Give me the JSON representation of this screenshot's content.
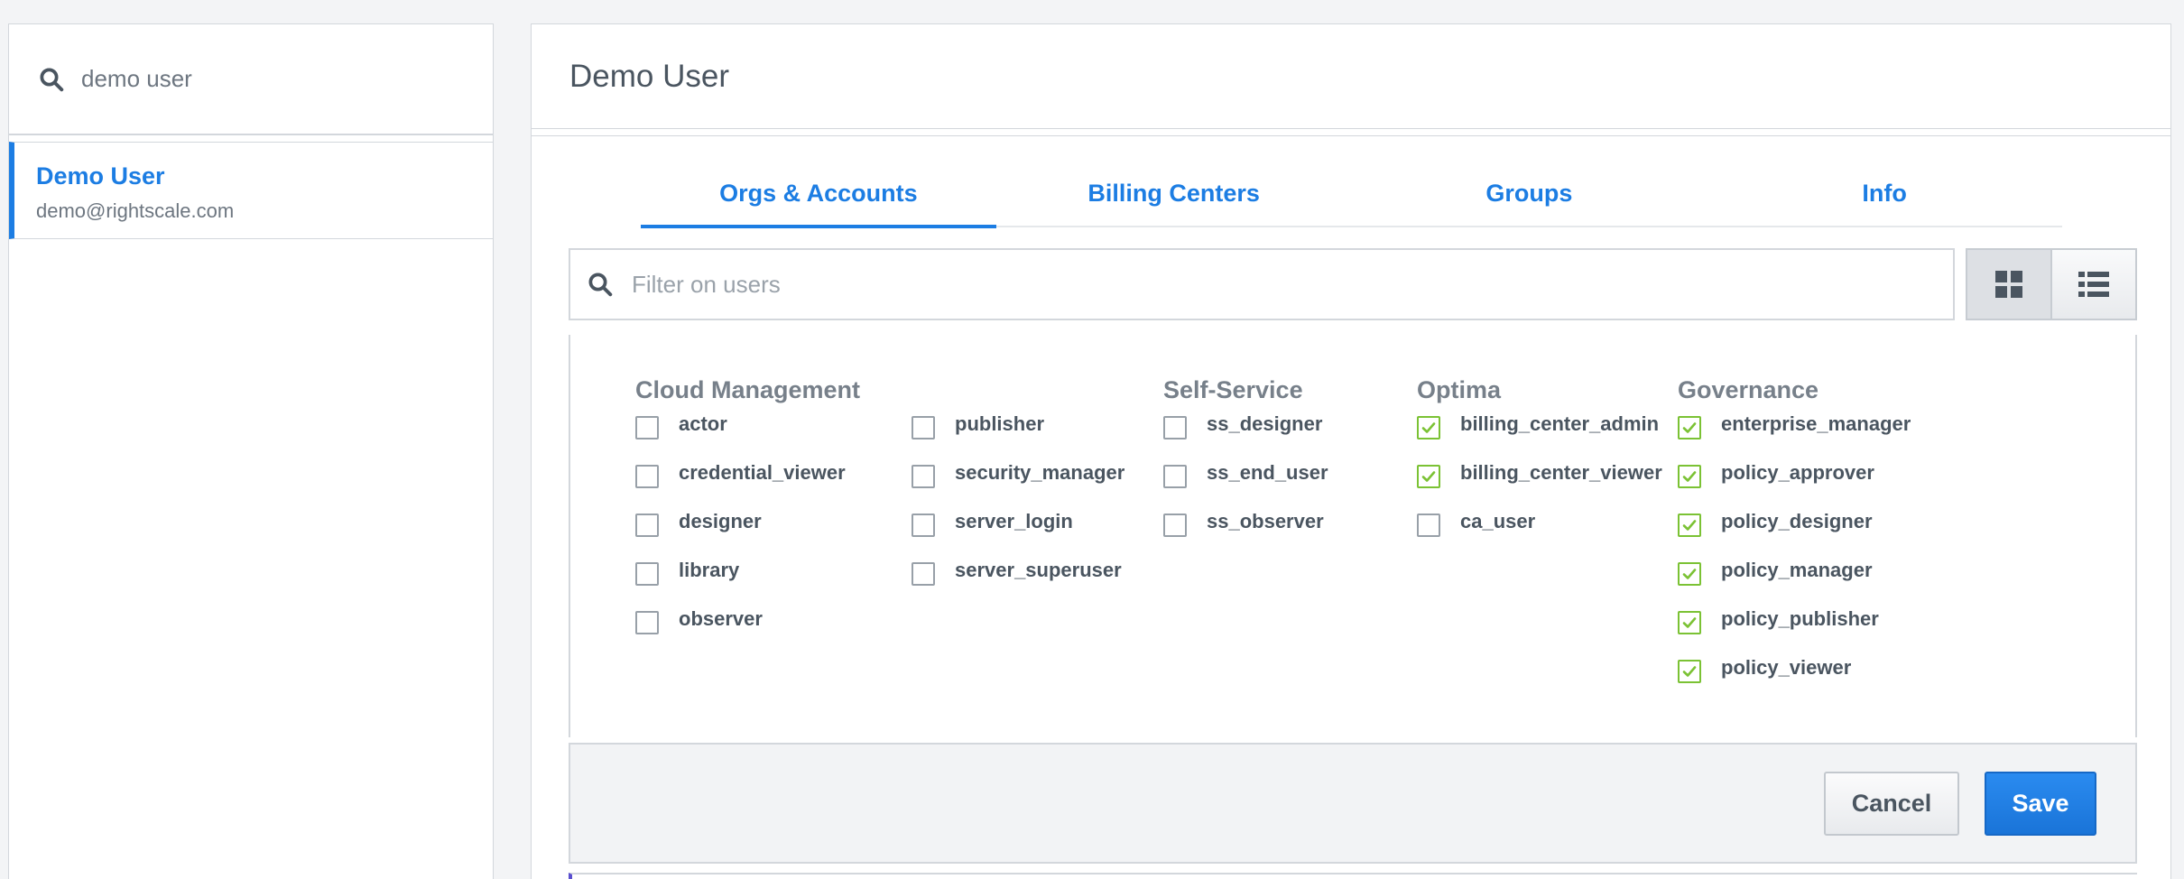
{
  "sidebar": {
    "search_value": "demo user",
    "users": [
      {
        "name": "Demo User",
        "email": "demo@rightscale.com"
      }
    ]
  },
  "detail": {
    "title": "Demo User",
    "tabs": [
      {
        "label": "Orgs & Accounts",
        "active": true
      },
      {
        "label": "Billing Centers",
        "active": false
      },
      {
        "label": "Groups",
        "active": false
      },
      {
        "label": "Info",
        "active": false
      }
    ],
    "filter_placeholder": "Filter on users",
    "view_toggle": [
      "grid-view-icon",
      "list-view-icon"
    ],
    "role_groups": [
      {
        "title": "Cloud Management"
      },
      {
        "title": "Self-Service"
      },
      {
        "title": "Optima"
      },
      {
        "title": "Governance"
      }
    ],
    "roles": {
      "cm_col1": [
        {
          "label": "actor",
          "checked": false
        },
        {
          "label": "credential_viewer",
          "checked": false
        },
        {
          "label": "designer",
          "checked": false
        },
        {
          "label": "library",
          "checked": false
        },
        {
          "label": "observer",
          "checked": false
        }
      ],
      "cm_col2": [
        {
          "label": "publisher",
          "checked": false
        },
        {
          "label": "security_manager",
          "checked": false
        },
        {
          "label": "server_login",
          "checked": false
        },
        {
          "label": "server_superuser",
          "checked": false
        }
      ],
      "self_service": [
        {
          "label": "ss_designer",
          "checked": false
        },
        {
          "label": "ss_end_user",
          "checked": false
        },
        {
          "label": "ss_observer",
          "checked": false
        }
      ],
      "optima": [
        {
          "label": "billing_center_admin",
          "checked": true
        },
        {
          "label": "billing_center_viewer",
          "checked": true
        },
        {
          "label": "ca_user",
          "checked": false
        }
      ],
      "governance": [
        {
          "label": "enterprise_manager",
          "checked": true
        },
        {
          "label": "policy_approver",
          "checked": true
        },
        {
          "label": "policy_designer",
          "checked": true
        },
        {
          "label": "policy_manager",
          "checked": true
        },
        {
          "label": "policy_publisher",
          "checked": true
        },
        {
          "label": "policy_viewer",
          "checked": true
        }
      ]
    },
    "actions": {
      "cancel": "Cancel",
      "save": "Save"
    }
  },
  "colors": {
    "accent": "#1c7de3",
    "check": "#7bc234",
    "text": "#4a5560",
    "muted": "#77808a"
  }
}
